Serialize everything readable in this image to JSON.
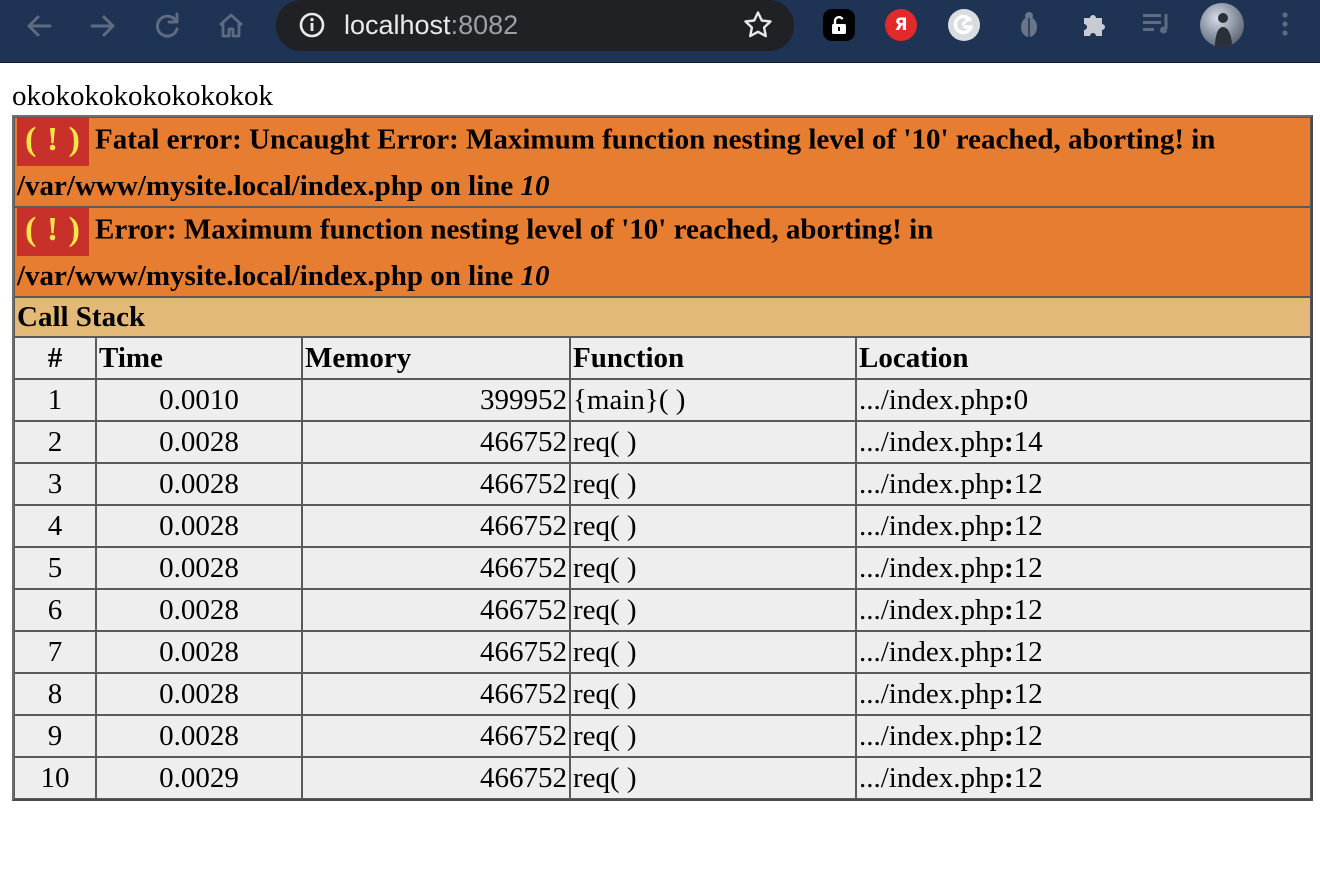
{
  "browser": {
    "url_host": "localhost",
    "url_port": ":8082",
    "yandex_ext_label": "Я",
    "colors": {
      "toolbar": "#1f3355",
      "omnibox": "#202124"
    }
  },
  "page": {
    "output_text": "okokokokokokokokok",
    "errors": [
      {
        "icon_label": "( ! )",
        "message": "Fatal error: Uncaught Error: Maximum function nesting level of '10' reached, aborting! in /var/www/mysite.local/index.php on line ",
        "line": "10"
      },
      {
        "icon_label": "( ! )",
        "message": "Error: Maximum function nesting level of '10' reached, aborting! in /var/www/mysite.local/index.php on line ",
        "line": "10"
      }
    ],
    "call_stack_title": "Call Stack",
    "headers": {
      "num": "#",
      "time": "Time",
      "memory": "Memory",
      "function": "Function",
      "location": "Location"
    },
    "rows": [
      {
        "num": "1",
        "time": "0.0010",
        "memory": "399952",
        "function": "{main}( )",
        "loc_file": ".../index.php",
        "loc_sep": ":",
        "loc_line": "0"
      },
      {
        "num": "2",
        "time": "0.0028",
        "memory": "466752",
        "function": "req( )",
        "loc_file": ".../index.php",
        "loc_sep": ":",
        "loc_line": "14"
      },
      {
        "num": "3",
        "time": "0.0028",
        "memory": "466752",
        "function": "req( )",
        "loc_file": ".../index.php",
        "loc_sep": ":",
        "loc_line": "12"
      },
      {
        "num": "4",
        "time": "0.0028",
        "memory": "466752",
        "function": "req( )",
        "loc_file": ".../index.php",
        "loc_sep": ":",
        "loc_line": "12"
      },
      {
        "num": "5",
        "time": "0.0028",
        "memory": "466752",
        "function": "req( )",
        "loc_file": ".../index.php",
        "loc_sep": ":",
        "loc_line": "12"
      },
      {
        "num": "6",
        "time": "0.0028",
        "memory": "466752",
        "function": "req( )",
        "loc_file": ".../index.php",
        "loc_sep": ":",
        "loc_line": "12"
      },
      {
        "num": "7",
        "time": "0.0028",
        "memory": "466752",
        "function": "req( )",
        "loc_file": ".../index.php",
        "loc_sep": ":",
        "loc_line": "12"
      },
      {
        "num": "8",
        "time": "0.0028",
        "memory": "466752",
        "function": "req( )",
        "loc_file": ".../index.php",
        "loc_sep": ":",
        "loc_line": "12"
      },
      {
        "num": "9",
        "time": "0.0028",
        "memory": "466752",
        "function": "req( )",
        "loc_file": ".../index.php",
        "loc_sep": ":",
        "loc_line": "12"
      },
      {
        "num": "10",
        "time": "0.0029",
        "memory": "466752",
        "function": "req( )",
        "loc_file": ".../index.php",
        "loc_sep": ":",
        "loc_line": "12"
      }
    ],
    "colors": {
      "error_bg": "#e77d30",
      "call_stack_bg": "#e3b978",
      "cell_bg": "#eeeeee",
      "warn_icon_bg": "#c8302a",
      "warn_icon_fg": "#f5e64a"
    }
  }
}
